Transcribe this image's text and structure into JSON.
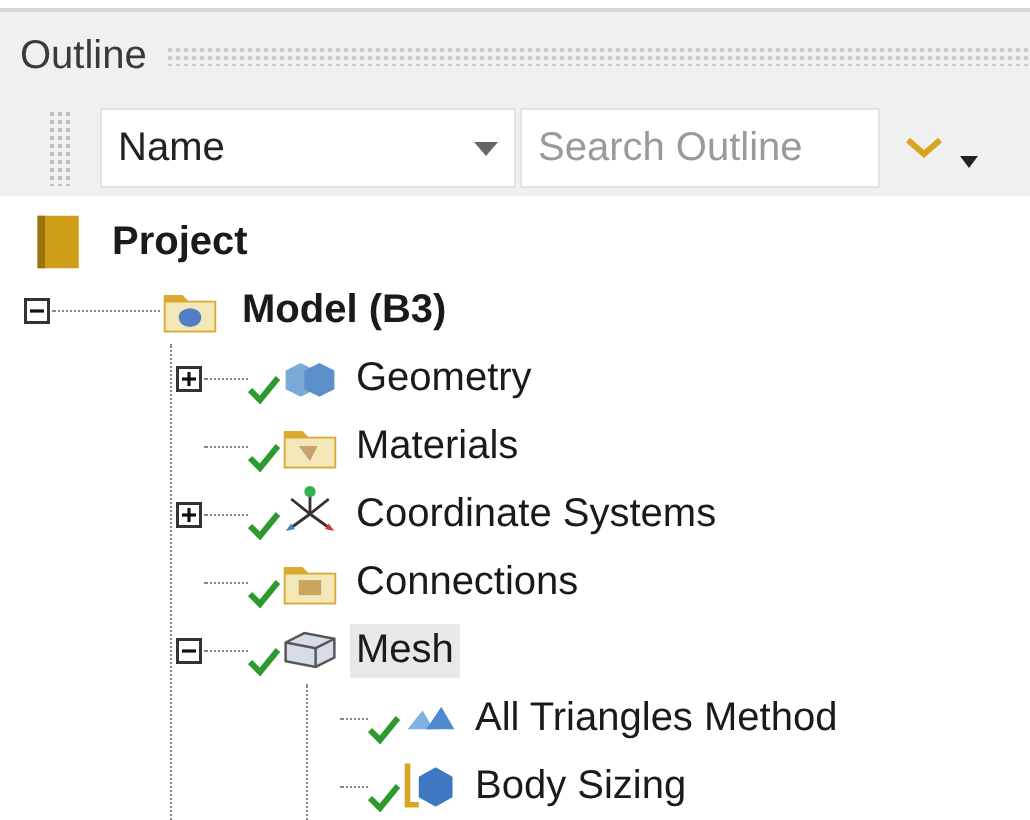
{
  "panel": {
    "title": "Outline"
  },
  "toolbar": {
    "column": "Name",
    "search": {
      "placeholder": "Search Outline"
    }
  },
  "tree": [
    {
      "label": "Project",
      "kind": "project",
      "children": [
        {
          "label": "Model (B3)",
          "kind": "model",
          "expanded": true,
          "selected": false,
          "children": [
            {
              "label": "Geometry",
              "kind": "geometry",
              "expanded": false,
              "checked": true,
              "selected": false
            },
            {
              "label": "Materials",
              "kind": "materials",
              "checked": true,
              "selected": false
            },
            {
              "label": "Coordinate Systems",
              "kind": "coordinates",
              "expanded": false,
              "checked": true,
              "selected": false
            },
            {
              "label": "Connections",
              "kind": "connections",
              "checked": true,
              "selected": false
            },
            {
              "label": "Mesh",
              "kind": "mesh",
              "expanded": true,
              "checked": true,
              "selected": true,
              "children": [
                {
                  "label": "All Triangles Method",
                  "kind": "method",
                  "checked": true,
                  "selected": false
                },
                {
                  "label": "Body Sizing",
                  "kind": "sizing",
                  "checked": true,
                  "selected": false
                }
              ]
            }
          ]
        }
      ]
    }
  ]
}
